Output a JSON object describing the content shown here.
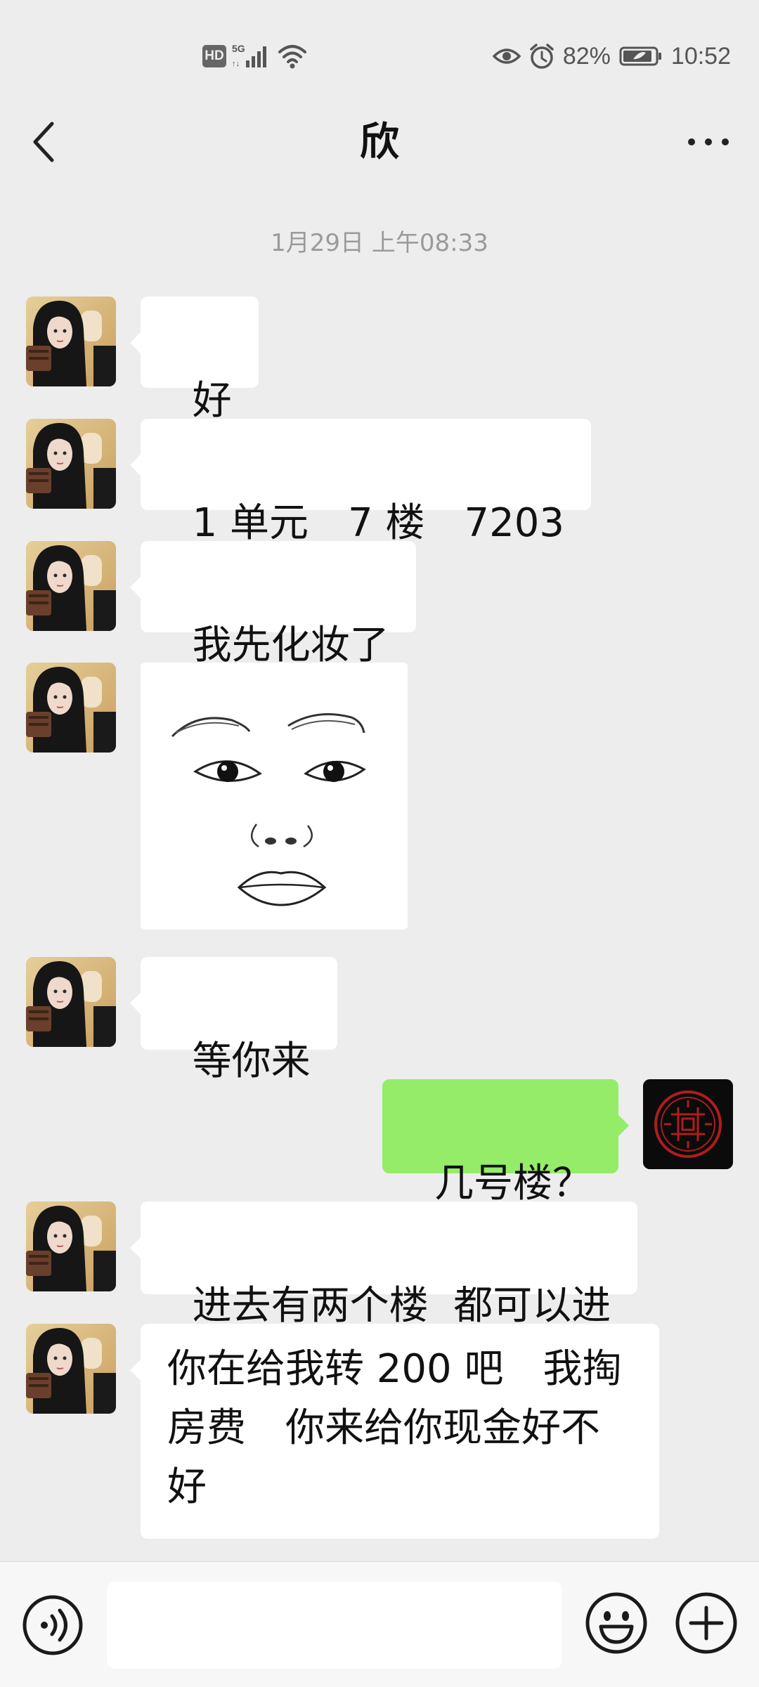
{
  "status_bar": {
    "hd_label": "HD",
    "network_label": "5G",
    "battery_percent": "82%",
    "time": "10:52",
    "icons": [
      "signal-icon",
      "wifi-icon",
      "eye-icon",
      "alarm-icon",
      "battery-icon"
    ]
  },
  "nav": {
    "title": "欣",
    "back_icon": "chevron-left-icon",
    "more_icon": "more-dots-icon"
  },
  "chat": {
    "timestamp": "1月29日 上午08:33",
    "messages": [
      {
        "from": "contact",
        "type": "text",
        "text": "好"
      },
      {
        "from": "contact",
        "type": "text",
        "text": "1 单元　7 楼　7203"
      },
      {
        "from": "contact",
        "type": "text",
        "text": "我先化妆了"
      },
      {
        "from": "contact",
        "type": "sticker",
        "description_icon": "surprised-face-sticker"
      },
      {
        "from": "contact",
        "type": "text",
        "text": "等你来"
      },
      {
        "from": "self",
        "type": "text",
        "text": "几号楼？"
      },
      {
        "from": "contact",
        "type": "text",
        "text": "进去有两个楼  都可以进"
      },
      {
        "from": "contact",
        "type": "text",
        "text": "你在给我转 200 吧　我掏房费　你来给你现金好不好"
      }
    ]
  },
  "input_bar": {
    "placeholder": "",
    "icons": [
      "voice-icon",
      "emoji-icon",
      "plus-icon"
    ]
  },
  "colors": {
    "background": "#ededed",
    "incoming_bubble": "#ffffff",
    "outgoing_bubble": "#95ec69",
    "timestamp": "#9a9a9a"
  }
}
